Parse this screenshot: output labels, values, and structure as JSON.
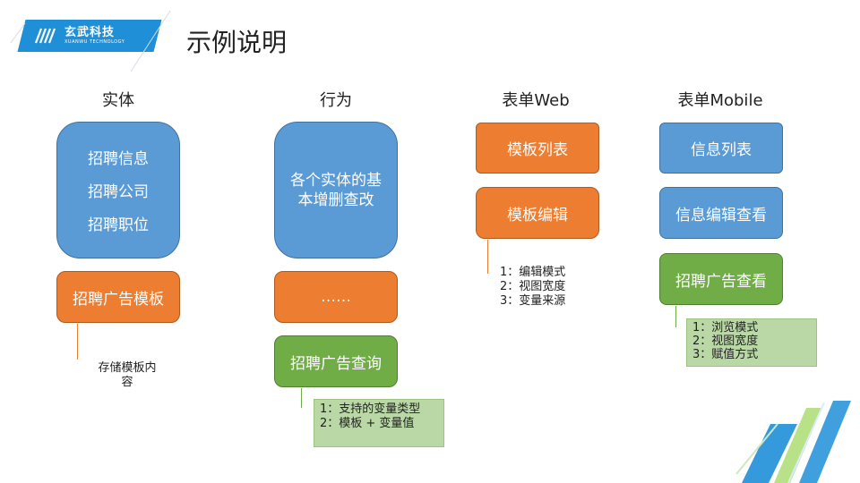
{
  "logo": {
    "name": "玄武科技",
    "english": "XUANWU TECHNOLOGY",
    "brand_color": "#1f8fd8"
  },
  "page_title": "示例说明",
  "columns": [
    {
      "title": "实体",
      "main_box_lines": [
        "招聘信息",
        "招聘公司",
        "招聘职位"
      ],
      "second_box": "招聘广告模板",
      "note": "存储模板内容"
    },
    {
      "title": "行为",
      "main_box": "各个实体的基本增删查改",
      "second_box": "……",
      "third_box": "招聘广告查询",
      "note_lines": [
        "1：支持的变量类型",
        "2：模板 + 变量值"
      ]
    },
    {
      "title": "表单Web",
      "box1": "模板列表",
      "box2": "模板编辑",
      "note_lines": [
        "1：编辑模式",
        "2：视图宽度",
        "3：变量来源"
      ]
    },
    {
      "title": "表单Mobile",
      "box1": "信息列表",
      "box2": "信息编辑查看",
      "box3": "招聘广告查看",
      "note_lines": [
        "1：浏览模式",
        "2：视图宽度",
        "3：赋值方式"
      ]
    }
  ],
  "colors": {
    "blue": "#5b9bd5",
    "orange": "#ed7d31",
    "green": "#70ad47",
    "note_green": "#b9d8a5"
  }
}
